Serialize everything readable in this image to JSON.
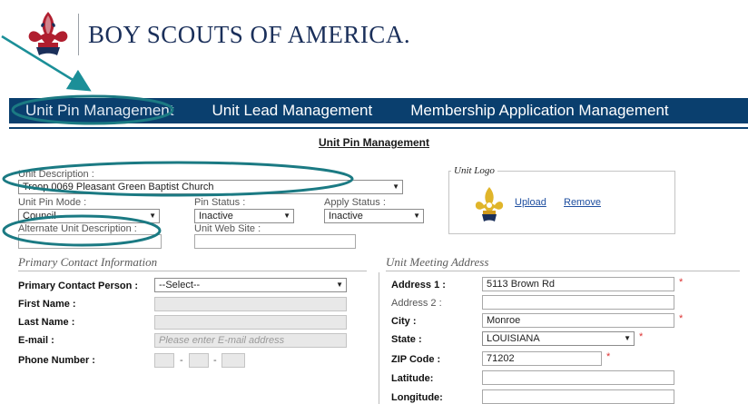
{
  "brand": {
    "name": "BOY SCOUTS OF AMERICA."
  },
  "nav": {
    "tabs": [
      "Unit Pin Management",
      "Unit Lead Management",
      "Membership Application Management"
    ]
  },
  "page": {
    "title": "Unit Pin Management"
  },
  "unit": {
    "description_label": "Unit Description :",
    "description_value": "Troop 0069 Pleasant Green Baptist Church",
    "pin_mode_label": "Unit Pin Mode :",
    "pin_mode_value": "Council",
    "pin_status_label": "Pin Status :",
    "pin_status_value": "Inactive",
    "apply_status_label": "Apply Status :",
    "apply_status_value": "Inactive",
    "alt_desc_label": "Alternate Unit Description :",
    "alt_desc_value": "",
    "web_site_label": "Unit Web Site :",
    "web_site_value": ""
  },
  "logo_box": {
    "legend": "Unit Logo",
    "upload": "Upload",
    "remove": "Remove"
  },
  "contact": {
    "heading": "Primary Contact Information",
    "person_label": "Primary Contact Person :",
    "person_value": "--Select--",
    "first_name_label": "First Name :",
    "first_name_value": "",
    "last_name_label": "Last Name :",
    "last_name_value": "",
    "email_label": "E-mail :",
    "email_placeholder": "Please enter E-mail address",
    "phone_label": "Phone Number :",
    "phone_sep": "-"
  },
  "address": {
    "heading": "Unit Meeting Address",
    "address1_label": "Address 1 :",
    "address1_value": "5113 Brown Rd",
    "address2_label": "Address 2 :",
    "address2_value": "",
    "city_label": "City :",
    "city_value": "Monroe",
    "state_label": "State :",
    "state_value": "LOUISIANA",
    "zip_label": "ZIP Code :",
    "zip_value": "71202",
    "latitude_label": "Latitude:",
    "latitude_value": "",
    "longitude_label": "Longitude:",
    "longitude_value": "",
    "required_mark": "*"
  },
  "colors": {
    "nav": "#0a3f6e",
    "annotation": "#1b8f98",
    "brand": "#1a2f5a"
  }
}
